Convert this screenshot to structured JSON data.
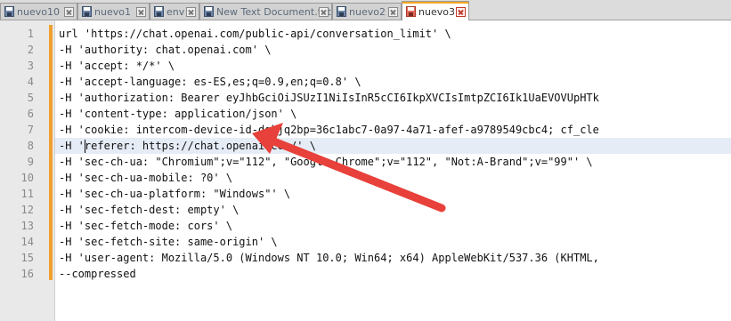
{
  "tabs": [
    {
      "label": "nuevo10",
      "active": false
    },
    {
      "label": "nuevo1",
      "active": false
    },
    {
      "label": "env",
      "active": false
    },
    {
      "label": "New Text Document.txt",
      "active": false
    },
    {
      "label": "nuevo2",
      "active": false
    },
    {
      "label": "nuevo3",
      "active": true
    }
  ],
  "editor": {
    "current_line": 8,
    "lines": [
      {
        "num": "1",
        "text": "url 'https://chat.openai.com/public-api/conversation_limit' \\"
      },
      {
        "num": "2",
        "text": "-H 'authority: chat.openai.com' \\"
      },
      {
        "num": "3",
        "text": "-H 'accept: */*' \\"
      },
      {
        "num": "4",
        "text": "-H 'accept-language: es-ES,es;q=0.9,en;q=0.8' \\"
      },
      {
        "num": "5",
        "text": "-H 'authorization: Bearer eyJhbGciOiJSUzI1NiIsInR5cCI6IkpXVCIsImtpZCI6Ik1UaEVOVUpHTk"
      },
      {
        "num": "6",
        "text": "-H 'content-type: application/json' \\"
      },
      {
        "num": "7",
        "text": "-H 'cookie: intercom-device-id-dgkjq2bp=36c1abc7-0a97-4a71-afef-a9789549cbc4; cf_cle"
      },
      {
        "num": "8",
        "text": "-H 'referer: https://chat.openai.com/' \\"
      },
      {
        "num": "9",
        "text": "-H 'sec-ch-ua: \"Chromium\";v=\"112\", \"Google Chrome\";v=\"112\", \"Not:A-Brand\";v=\"99\"' \\"
      },
      {
        "num": "10",
        "text": "-H 'sec-ch-ua-mobile: ?0' \\"
      },
      {
        "num": "11",
        "text": "-H 'sec-ch-ua-platform: \"Windows\"' \\"
      },
      {
        "num": "12",
        "text": "-H 'sec-fetch-dest: empty' \\"
      },
      {
        "num": "13",
        "text": "-H 'sec-fetch-mode: cors' \\"
      },
      {
        "num": "14",
        "text": "-H 'sec-fetch-site: same-origin' \\"
      },
      {
        "num": "15",
        "text": "-H 'user-agent: Mozilla/5.0 (Windows NT 10.0; Win64; x64) AppleWebKit/537.36 (KHTML,"
      },
      {
        "num": "16",
        "text": "--compressed"
      }
    ]
  },
  "annotation": {
    "arrow_color": "#e8403a"
  },
  "colors": {
    "accent": "#f5a623",
    "gutter_change": "#f0a030",
    "current_line": "#e6ecf6"
  }
}
